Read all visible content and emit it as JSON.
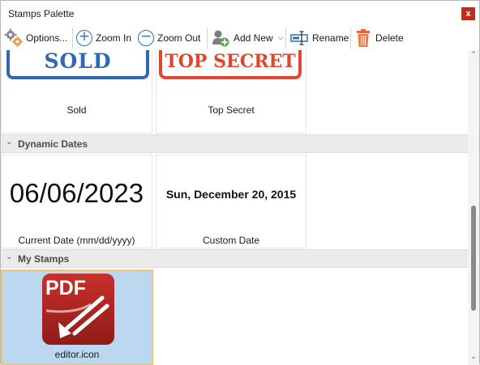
{
  "window": {
    "title": "Stamps Palette",
    "close_glyph": "x"
  },
  "toolbar": {
    "options_label": "Options...",
    "zoom_in_label": "Zoom In",
    "zoom_out_label": "Zoom Out",
    "add_new_label": "Add New",
    "rename_label": "Rename",
    "delete_label": "Delete"
  },
  "groups": {
    "standard": {
      "stamps": [
        {
          "stamp_text": "SOLD",
          "caption": "Sold",
          "color": "#2f69b3"
        },
        {
          "stamp_text": "TOP SECRET",
          "caption": "Top Secret",
          "color": "#e0462d"
        }
      ]
    },
    "dynamic_dates": {
      "label": "Dynamic Dates",
      "stamps": [
        {
          "preview": "06/06/2023",
          "caption": "Current Date (mm/dd/yyyy)"
        },
        {
          "preview": "Sun, December 20, 2015",
          "caption": "Custom Date"
        }
      ]
    },
    "my_stamps": {
      "label": "My Stamps",
      "stamps": [
        {
          "preview": "PDF",
          "caption": "editor.icon",
          "selected": true
        }
      ]
    }
  },
  "colors": {
    "selection": "#bcd8f0",
    "selection_border": "#e8c873",
    "accent": "#2d6fb7",
    "close": "#c42b1c"
  }
}
